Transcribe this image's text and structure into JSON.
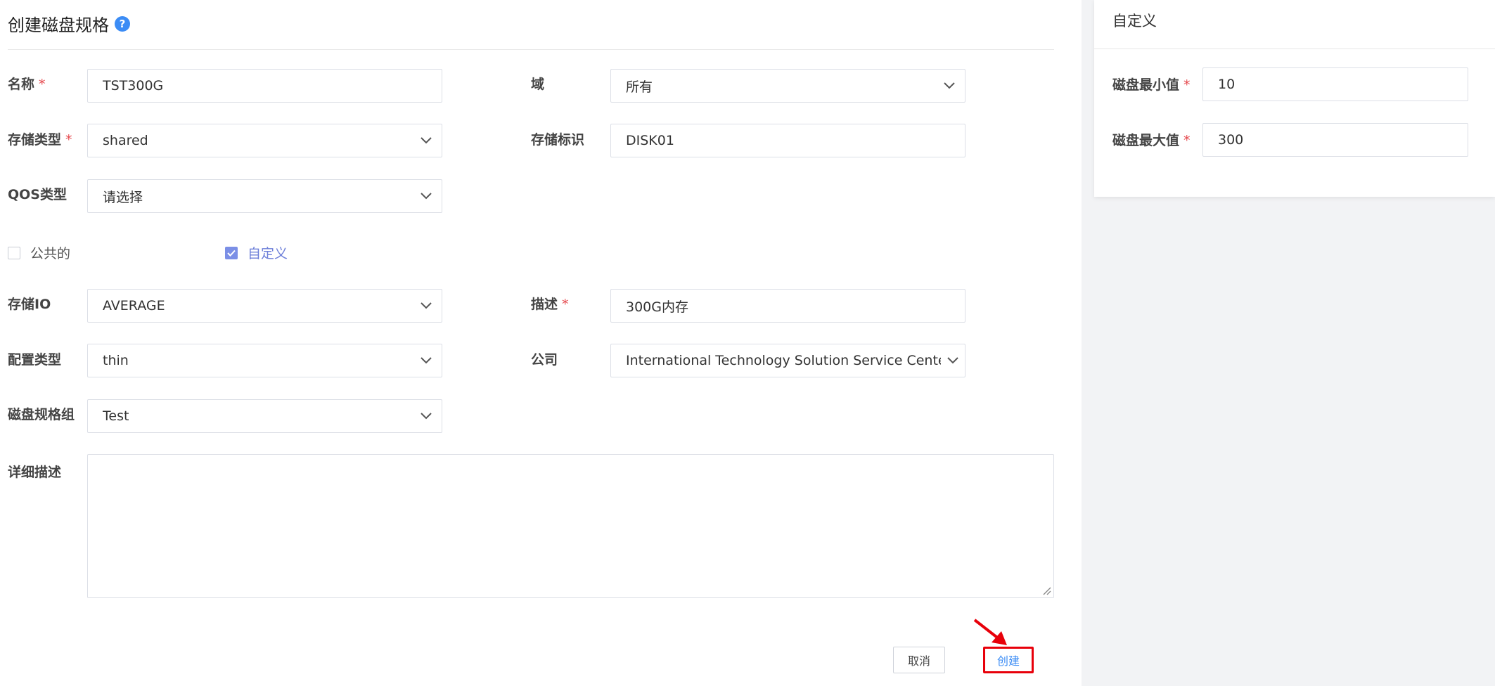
{
  "dialog": {
    "title": "创建磁盘规格",
    "help_icon": "?"
  },
  "form": {
    "name": {
      "label": "名称",
      "value": "TST300G"
    },
    "domain": {
      "label": "域",
      "value": "所有"
    },
    "storage_type": {
      "label": "存储类型",
      "value": "shared"
    },
    "storage_tag": {
      "label": "存储标识",
      "value": "DISK01"
    },
    "qos_type": {
      "label": "QOS类型",
      "placeholder": "请选择"
    },
    "public": {
      "label": "公共的",
      "checked": false
    },
    "custom": {
      "label": "自定义",
      "checked": true
    },
    "storage_io": {
      "label": "存储IO",
      "value": "AVERAGE"
    },
    "description": {
      "label": "描述",
      "value": "300G内存"
    },
    "provision_type": {
      "label": "配置类型",
      "value": "thin"
    },
    "company": {
      "label": "公司",
      "value": "International Technology Solution Service Center-"
    },
    "disk_spec_group": {
      "label": "磁盘规格组",
      "value": "Test"
    },
    "detail": {
      "label": "详细描述",
      "value": ""
    },
    "required_mark": "*"
  },
  "custom_panel": {
    "title": "自定义",
    "disk_min": {
      "label": "磁盘最小值",
      "value": "10"
    },
    "disk_max": {
      "label": "磁盘最大值",
      "value": "300"
    }
  },
  "actions": {
    "cancel_label": "取消",
    "create_label": "创建"
  },
  "colors": {
    "accent": "#3b8cf5",
    "required": "#e5484d",
    "highlight": "#e8000a",
    "checkbox": "#7b8fe6"
  }
}
